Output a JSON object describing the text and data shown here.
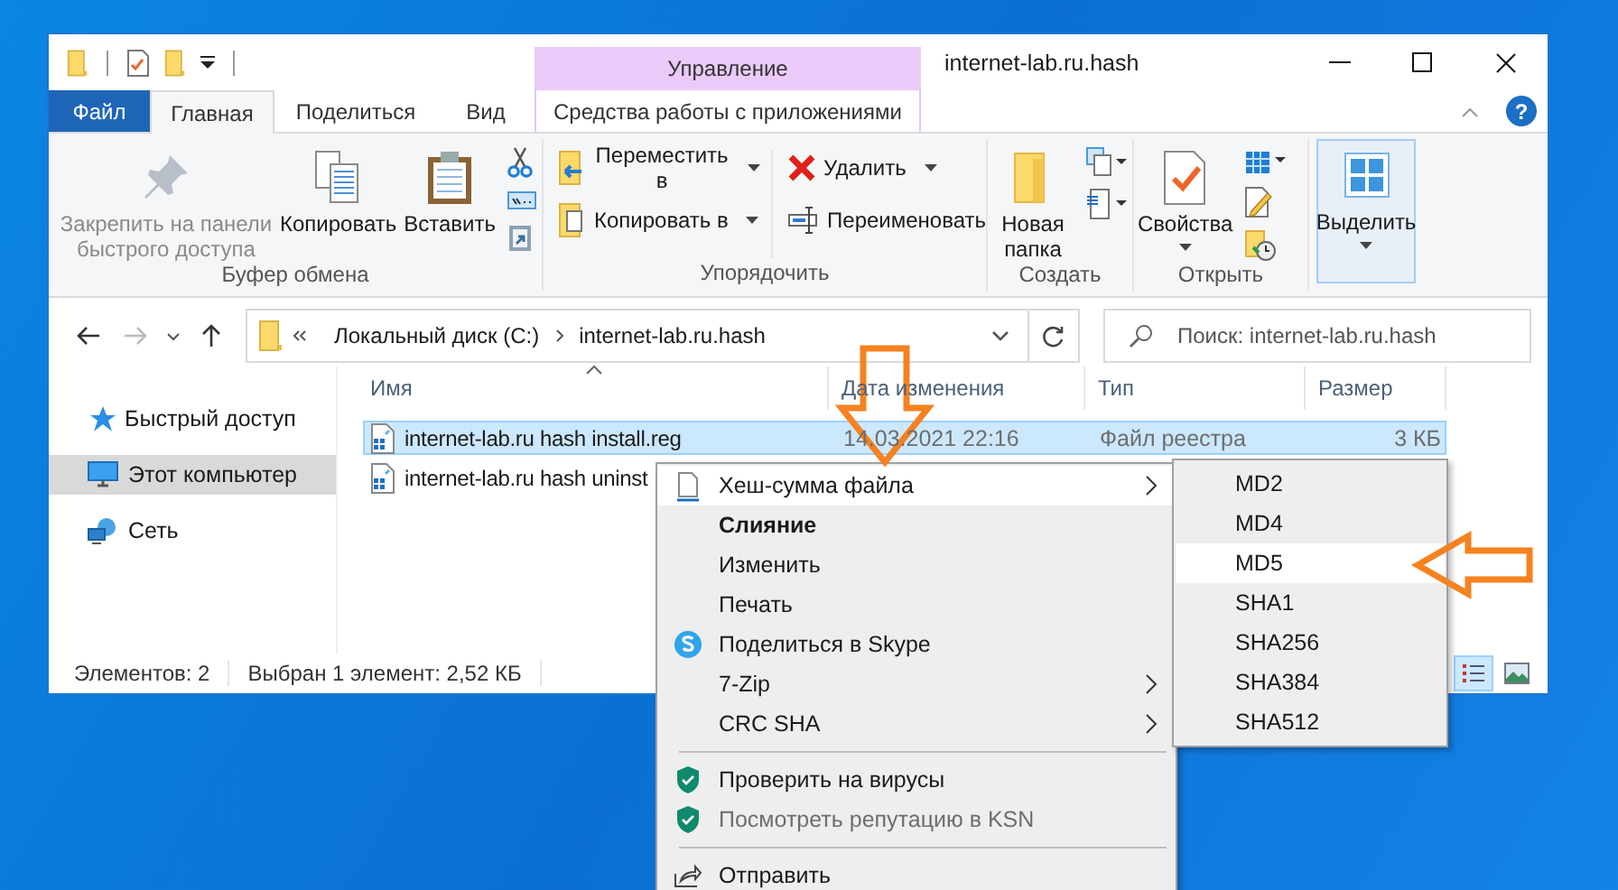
{
  "window": {
    "title": "internet-lab.ru.hash"
  },
  "contextual_tab_group": {
    "label": "Управление"
  },
  "help_button": "?",
  "ribbon_tabs": [
    {
      "label": "Файл",
      "kind": "file",
      "selected": false
    },
    {
      "label": "Главная",
      "kind": "tab",
      "selected": true
    },
    {
      "label": "Поделиться",
      "kind": "tab",
      "selected": false
    },
    {
      "label": "Вид",
      "kind": "tab",
      "selected": false
    },
    {
      "label": "Средства работы с приложениями",
      "kind": "contextual",
      "selected": false
    }
  ],
  "ribbon_groups": [
    {
      "label": "Буфер обмена",
      "buttons": [
        {
          "label": "Закрепить на панели быстрого доступа",
          "disabled": true,
          "dropdown": false,
          "highlighted": false
        },
        {
          "label": "Копировать",
          "disabled": false,
          "dropdown": false,
          "highlighted": false
        },
        {
          "label": "Вставить",
          "disabled": false,
          "dropdown": false,
          "highlighted": false
        }
      ]
    },
    {
      "label": "Упорядочить",
      "buttons": [
        {
          "label": "Переместить в",
          "disabled": false,
          "dropdown": true,
          "highlighted": false
        },
        {
          "label": "Копировать в",
          "disabled": false,
          "dropdown": true,
          "highlighted": false
        },
        {
          "label": "Удалить",
          "disabled": false,
          "dropdown": true,
          "highlighted": false
        },
        {
          "label": "Переименовать",
          "disabled": false,
          "dropdown": false,
          "highlighted": false
        }
      ]
    },
    {
      "label": "Создать",
      "buttons": [
        {
          "label": "Новая папка",
          "disabled": false,
          "dropdown": false,
          "highlighted": false
        }
      ]
    },
    {
      "label": "Открыть",
      "buttons": [
        {
          "label": "Свойства",
          "disabled": false,
          "dropdown": true,
          "highlighted": false
        }
      ]
    },
    {
      "buttons": [
        {
          "label": "Выделить",
          "disabled": false,
          "dropdown": true,
          "highlighted": true
        }
      ]
    }
  ],
  "navigation": {
    "forward_enabled": false
  },
  "address": {
    "path": [
      "Локальный диск (C:)",
      "internet-lab.ru.hash"
    ]
  },
  "search": {
    "placeholder": "Поиск: internet-lab.ru.hash"
  },
  "sidebar": {
    "items": [
      {
        "label": "Быстрый доступ",
        "selected": false
      },
      {
        "label": "Этот компьютер",
        "selected": true
      },
      {
        "label": "Сеть",
        "selected": false
      }
    ]
  },
  "table": {
    "columns": [
      "Имя",
      "Дата изменения",
      "Тип",
      "Размер"
    ],
    "rows": [
      {
        "name": "internet-lab.ru hash install.reg",
        "date": "14.03.2021 22:16",
        "type": "Файл реестра",
        "size": "3 КБ",
        "selected": true
      },
      {
        "name": "internet-lab.ru hash uninst",
        "selected": false
      }
    ]
  },
  "status_bar": [
    "Элементов: 2",
    "Выбран 1 элемент: 2,52 КБ"
  ],
  "views": [
    {
      "selected": true
    },
    {
      "selected": false
    }
  ],
  "context_menu": {
    "items": [
      {
        "kind": "item",
        "label": "Хеш-сумма файла",
        "selected": true,
        "bold": false,
        "disabled": false,
        "submenu": true
      },
      {
        "kind": "item",
        "label": "Слияние",
        "selected": false,
        "bold": true,
        "disabled": false,
        "submenu": false
      },
      {
        "kind": "item",
        "label": "Изменить",
        "selected": false,
        "bold": false,
        "disabled": false,
        "submenu": false
      },
      {
        "kind": "item",
        "label": "Печать",
        "selected": false,
        "bold": false,
        "disabled": false,
        "submenu": false
      },
      {
        "kind": "item",
        "label": "Поделиться в Skype",
        "selected": false,
        "bold": false,
        "disabled": false,
        "submenu": false
      },
      {
        "kind": "item",
        "label": "7-Zip",
        "selected": false,
        "bold": false,
        "disabled": false,
        "submenu": true
      },
      {
        "kind": "item",
        "label": "CRC SHA",
        "selected": false,
        "bold": false,
        "disabled": false,
        "submenu": true
      },
      {
        "kind": "separator"
      },
      {
        "kind": "item",
        "label": "Проверить на вирусы",
        "selected": false,
        "bold": false,
        "disabled": false,
        "submenu": false
      },
      {
        "kind": "item",
        "label": "Посмотреть репутацию в KSN",
        "selected": false,
        "bold": false,
        "disabled": true,
        "submenu": false
      },
      {
        "kind": "separator"
      },
      {
        "kind": "item",
        "label": "Отправить",
        "selected": false,
        "bold": false,
        "disabled": false,
        "submenu": false
      }
    ]
  },
  "submenu": {
    "items": [
      {
        "label": "MD2",
        "selected": false
      },
      {
        "label": "MD4",
        "selected": false
      },
      {
        "label": "MD5",
        "selected": true
      },
      {
        "label": "SHA1",
        "selected": false
      },
      {
        "label": "SHA256",
        "selected": false
      },
      {
        "label": "SHA384",
        "selected": false
      },
      {
        "label": "SHA512",
        "selected": false
      }
    ]
  }
}
